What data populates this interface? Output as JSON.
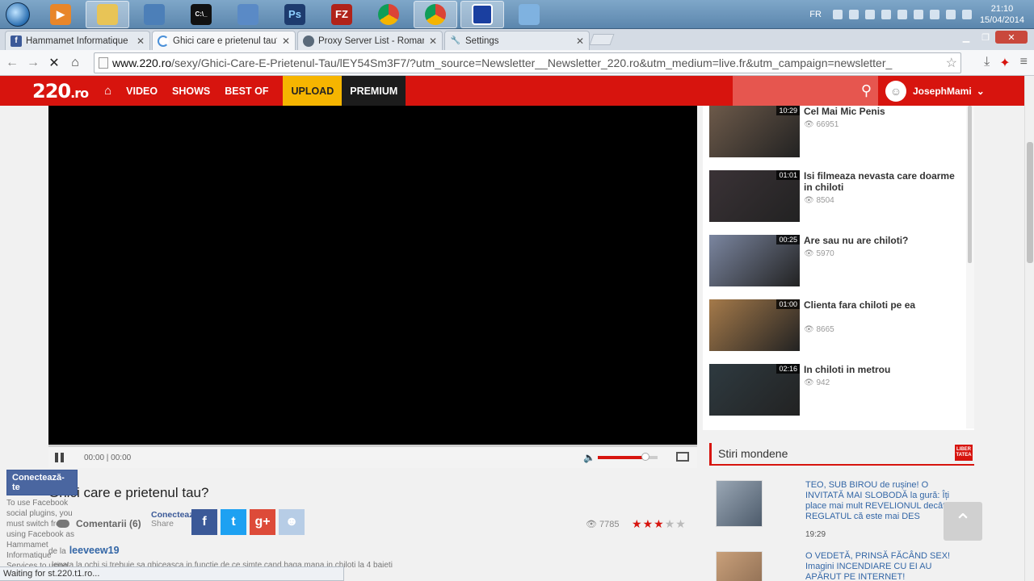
{
  "taskbar": {
    "language": "FR",
    "time": "21:10",
    "date": "15/04/2014"
  },
  "tabs": [
    {
      "title": "Hammamet Informatique",
      "favicon": "facebook-icon"
    },
    {
      "title": "Ghici care e prietenul tau?",
      "favicon": "loading-icon"
    },
    {
      "title": "Proxy Server List - Romani",
      "favicon": "globe-icon"
    },
    {
      "title": "Settings",
      "favicon": "wrench-icon"
    }
  ],
  "address": {
    "host": "www.220.ro",
    "path": "/sexy/Ghici-Care-E-Prietenul-Tau/lEY54Sm3F7/?utm_source=Newsletter__Newsletter_220.ro&utm_medium=live.fr&utm_campaign=newsletter_"
  },
  "site": {
    "logo_main": "220",
    "logo_suffix": ".ro",
    "nav": [
      "VIDEO",
      "SHOWS",
      "BEST OF"
    ],
    "upload": "UPLOAD",
    "premium": "PREMIUM",
    "username": "JosephMami"
  },
  "player": {
    "time": "00:00 | 00:00",
    "volume_level": 0.8
  },
  "video": {
    "title": "Ghici care e prietenul tau?",
    "comments": "Comentarii (6)",
    "connect": "Conectează-te",
    "share": "Share",
    "views": "7785",
    "rating": 3,
    "by_label": "de la",
    "author": "leeveew19",
    "description": "legata la ochi si trebuie sa ghiceasca in functie de ce simte cand baga mana in chiloti la 4 baieti"
  },
  "facebook_widget": {
    "button": "Conectează-te",
    "text": "To use Facebook social plugins, you must switch from using Facebook as Hammamet Informatique Services to using Facebook as"
  },
  "status_bar": "Waiting for st.220.t1.ro...",
  "related": [
    {
      "title": "Cel Mai Mic Penis",
      "views": "66951",
      "duration": "10:29",
      "color": "#6d5a4a"
    },
    {
      "title": "Isi filmeaza nevasta care doarme in chiloti",
      "views": "8504",
      "duration": "01:01",
      "color": "#3a3236"
    },
    {
      "title": "Are sau nu are chiloti?",
      "views": "5970",
      "duration": "00:25",
      "color": "#7b86a0"
    },
    {
      "title": "Clienta fara chiloti pe ea",
      "views": "8665",
      "duration": "01:00",
      "color": "#a57a4a"
    },
    {
      "title": "In chiloti in metrou",
      "views": "942",
      "duration": "02:16",
      "color": "#2e3a40"
    }
  ],
  "news_section": {
    "title": "Stiri mondene",
    "logo_text": "LIBER TATEA",
    "items": [
      {
        "text": "TEO, SUB BIROU de rușine! O INVITATĂ MAI SLOBODĂ la gură: Îți place mai mult REVELIONUL decât REGLATUL că este mai DES",
        "time": "19:29"
      },
      {
        "text": "O VEDETĂ, PRINSĂ FĂCÂND SEX! Imagini INCENDIARE CU EI AU APĂRUT PE INTERNET!",
        "time": ""
      }
    ]
  }
}
